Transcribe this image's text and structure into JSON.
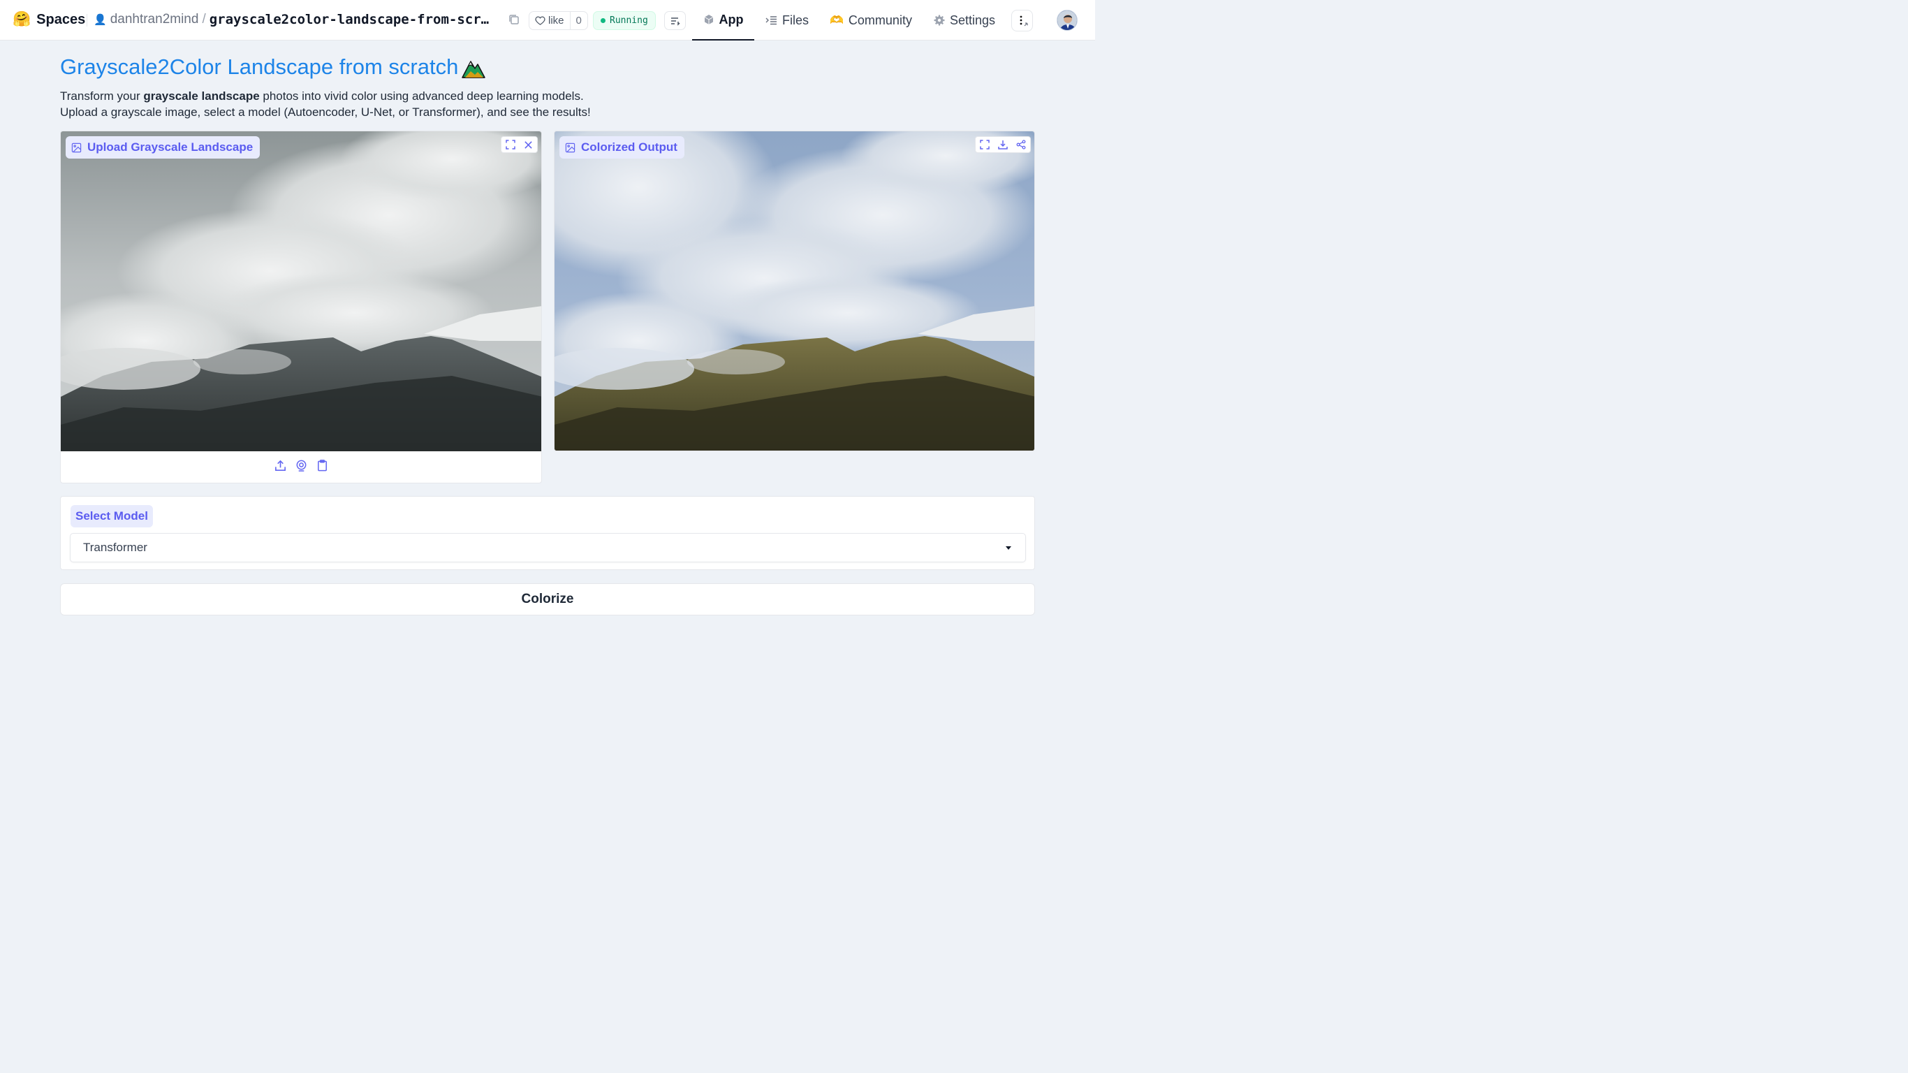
{
  "nav": {
    "brand": "Spaces",
    "owner": "danhtran2mind",
    "separator": "/",
    "repo": "grayscale2color-landscape-from-scr…",
    "like_label": "like",
    "like_count": "0",
    "status": "Running",
    "tabs": [
      {
        "label": "App",
        "active": true,
        "icon": "cube-icon"
      },
      {
        "label": "Files",
        "active": false,
        "icon": "files-icon"
      },
      {
        "label": "Community",
        "active": false,
        "icon": "community-icon"
      },
      {
        "label": "Settings",
        "active": false,
        "icon": "gear-icon"
      }
    ]
  },
  "page": {
    "title": "Grayscale2Color Landscape from scratch",
    "title_emoji": "🏔",
    "desc_line1_pre": "Transform your ",
    "desc_line1_bold": "grayscale landscape",
    "desc_line1_post": " photos into vivid color using advanced deep learning models.",
    "desc_line2": "Upload a grayscale image, select a model (Autoencoder, U-Net, or Transformer), and see the results!"
  },
  "input_panel": {
    "label": "Upload Grayscale Landscape",
    "tools": [
      "fullscreen-icon",
      "close-icon"
    ],
    "sources": [
      "upload-icon",
      "webcam-icon",
      "clipboard-icon"
    ]
  },
  "output_panel": {
    "label": "Colorized Output",
    "tools": [
      "fullscreen-icon",
      "download-icon",
      "share-icon"
    ]
  },
  "model": {
    "label": "Select Model",
    "selected": "Transformer"
  },
  "action": {
    "colorize_label": "Colorize"
  },
  "colors": {
    "accent": "#5b5cf0",
    "title": "#1d84e8",
    "running": "#047857",
    "background": "#eef2f7"
  }
}
